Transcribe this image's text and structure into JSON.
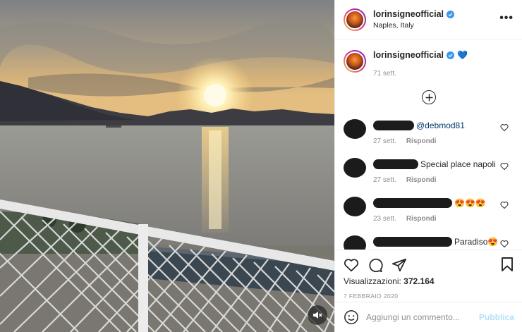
{
  "post": {
    "username": "lorinsigneofficial",
    "location": "Naples, Italy",
    "more_label": "•••"
  },
  "caption": {
    "username": "lorinsigneofficial",
    "emoji": "💙",
    "time": "71 sett."
  },
  "comments": [
    {
      "text": "@debmod81",
      "is_mention": true,
      "time": "27 sett.",
      "reply": "Rispondi",
      "redact_width": 58
    },
    {
      "text": "Special place napoli",
      "is_mention": false,
      "time": "27 sett.",
      "reply": "Rispondi",
      "redact_width": 64
    },
    {
      "text": "😍😍😍",
      "is_mention": false,
      "time": "23 sett.",
      "reply": "Rispondi",
      "redact_width": 112
    },
    {
      "text": "Paradiso😍",
      "is_mention": false,
      "time": "",
      "reply": "",
      "redact_width": 112
    }
  ],
  "stats": {
    "views_label": "Visualizzazioni:",
    "views_value": "372.164",
    "date": "7 FEBBRAIO 2020"
  },
  "add_comment": {
    "placeholder": "Aggiungi un commento...",
    "publish_label": "Pubblica"
  },
  "icons": {
    "verified": "verified-badge-icon",
    "more": "more-options-icon",
    "load_more": "plus-circle-icon",
    "like": "heart-icon",
    "comment": "comment-icon",
    "share": "share-icon",
    "save": "bookmark-icon",
    "emoji": "emoji-icon",
    "mute": "speaker-muted-icon"
  },
  "colors": {
    "verified_blue": "#3897f0",
    "publish_disabled": "#b2dffc",
    "secondary_text": "#8e8e8e",
    "primary_text": "#262626"
  }
}
